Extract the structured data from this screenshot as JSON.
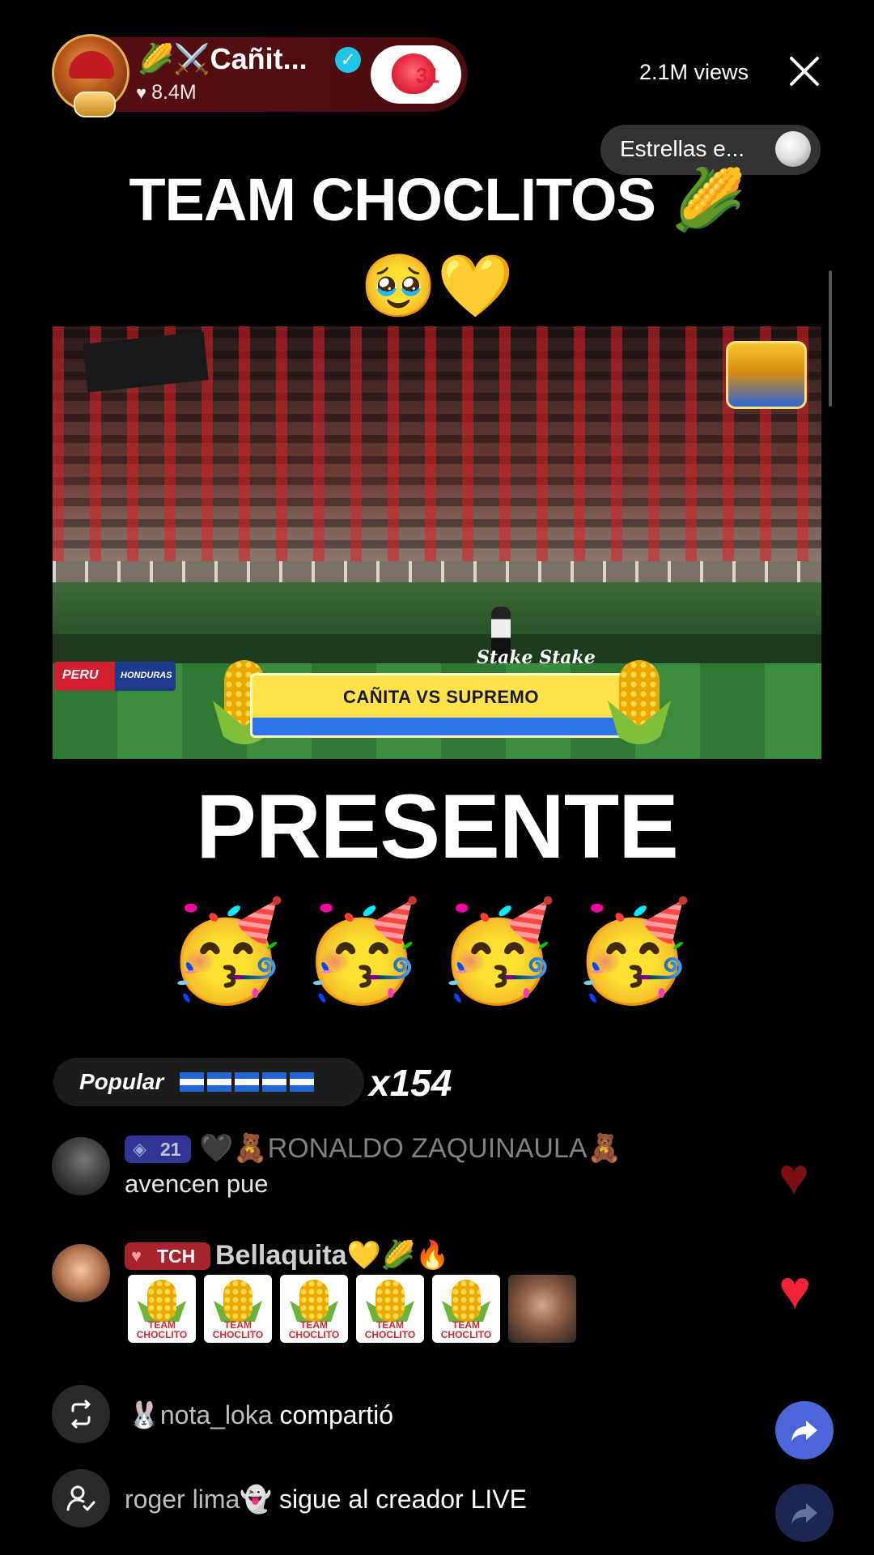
{
  "host": {
    "name": "🌽⚔️Cañit...",
    "likes": "8.4M",
    "gift_count": "31"
  },
  "header": {
    "views": "2.1M views",
    "ranking_label": "Estrellas e..."
  },
  "overlay": {
    "headline": "TEAM CHOCLITOS 🌽",
    "headline_emoji": "🥹💛",
    "presente": "PRESENTE",
    "party_emojis": "🥳🥳🥳🥳"
  },
  "video": {
    "match_title": "CAÑITA VS SUPREMO",
    "sponsor": "Stake Stake",
    "flag_left": "PERU",
    "flag_right": "HONDURAS"
  },
  "gift_combo": {
    "label": "Popular",
    "count": "x154"
  },
  "chat": [
    {
      "badge_level": "21",
      "username": "🖤🧸RONALDO ZAQUINAULA🧸",
      "message": "avencen pue"
    },
    {
      "badge": "TCH",
      "username": "Bellaquita💛🌽🔥",
      "stickers": [
        "TEAM CHOCLITO",
        "TEAM CHOCLITO",
        "TEAM CHOCLITO",
        "TEAM CHOCLITO",
        "TEAM CHOCLITO"
      ]
    }
  ],
  "activity": {
    "share_user": "🐰nota_loka",
    "share_action": "compartió",
    "follow_user": "roger lima👻",
    "follow_action": "sigue al creador LIVE"
  },
  "colors": {
    "host_pill": "#5a0f14",
    "accent_red": "#f02236",
    "share_blue": "#4b66d8"
  }
}
